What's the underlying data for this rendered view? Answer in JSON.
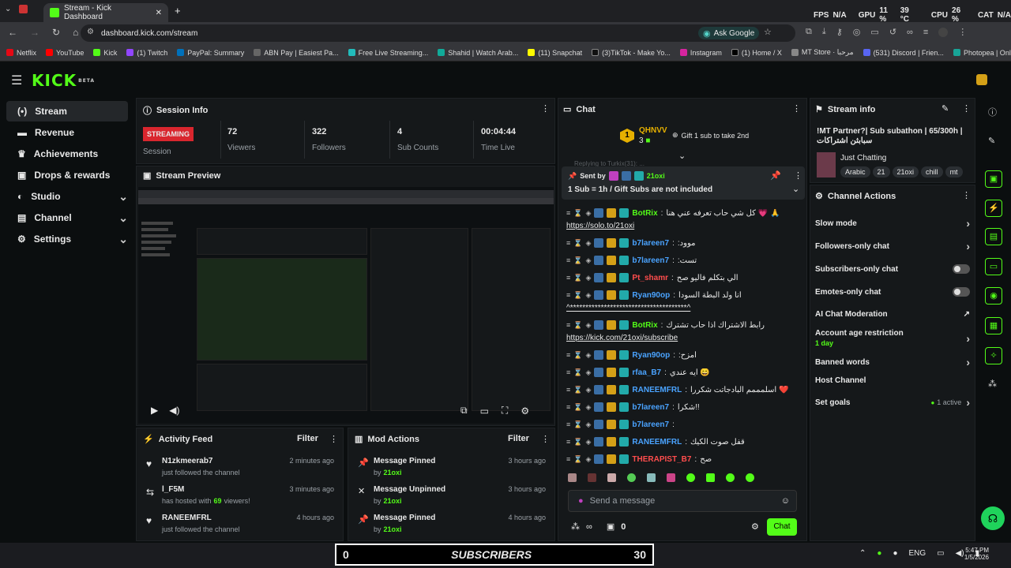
{
  "browser": {
    "tab_title": "Stream - Kick Dashboard",
    "url": "dashboard.kick.com/stream",
    "ask_google": "Ask Google",
    "overlay": {
      "fps_label": "FPS",
      "fps": "N/A",
      "gpu_label": "GPU",
      "gpu": "11 %",
      "gpu_temp": "39 °C",
      "cpu_label": "CPU",
      "cpu": "26 %",
      "cat": "CAT",
      "cat_val": "N/A"
    },
    "bookmarks": [
      "Netflix",
      "YouTube",
      "Kick",
      "(1) Twitch",
      "PayPal: Summary",
      "ABN Pay | Easiest Pa...",
      "Free Live Streaming...",
      "Shahid | Watch Arab...",
      "(11) Snapchat",
      "(3)TikTok - Make Yo...",
      "Instagram",
      "(1) Home / X",
      "MT Store · مرحبا",
      "(531) Discord | Frien...",
      "Photopea | Online P..."
    ]
  },
  "header": {
    "logo": "KICK",
    "beta": "BETA"
  },
  "sidebar": {
    "items": [
      {
        "label": "Stream"
      },
      {
        "label": "Revenue"
      },
      {
        "label": "Achievements"
      },
      {
        "label": "Drops & rewards"
      },
      {
        "label": "Studio"
      },
      {
        "label": "Channel"
      },
      {
        "label": "Settings"
      }
    ]
  },
  "session": {
    "title": "Session Info",
    "status": "STREAMING",
    "status_label": "Session",
    "stats": [
      {
        "value": "72",
        "label": "Viewers"
      },
      {
        "value": "322",
        "label": "Followers"
      },
      {
        "value": "4",
        "label": "Sub Counts"
      },
      {
        "value": "00:04:44",
        "label": "Time Live"
      }
    ]
  },
  "preview": {
    "title": "Stream Preview"
  },
  "activity": {
    "title": "Activity Feed",
    "filter": "Filter",
    "items": [
      {
        "name": "N1zkmeerab7",
        "desc": "just followed the channel",
        "time": "2 minutes ago"
      },
      {
        "name": "l_F5M",
        "desc_pre": "has hosted with",
        "count": "69",
        "desc_post": "viewers!",
        "time": "3 minutes ago"
      },
      {
        "name": "RANEEMFRL",
        "desc": "just followed the channel",
        "time": "4 hours ago"
      }
    ]
  },
  "mod": {
    "title": "Mod Actions",
    "filter": "Filter",
    "items": [
      {
        "action": "Message Pinned",
        "by": "by",
        "user": "21oxi",
        "time": "3 hours ago"
      },
      {
        "action": "Message Unpinned",
        "by": "by",
        "user": "21oxi",
        "time": "3 hours ago"
      },
      {
        "action": "Message Pinned",
        "by": "by",
        "user": "21oxi",
        "time": "4 hours ago"
      }
    ]
  },
  "chat": {
    "title": "Chat",
    "gift_user": "QHNVV",
    "gift_rank": "1",
    "gift_count": "3",
    "gift_cta": "Gift 1 sub to take 2nd",
    "replying": "Replying to Turkix(31): ...",
    "pinned": {
      "sent_by": "Sent by",
      "user": "21oxi",
      "text": "1 Sub = 1h / Gift Subs are not included"
    },
    "messages": [
      {
        "user": "BotRix",
        "color": "#53fc18",
        "text": "كل شي حاب تعرفه عني هنا 💗 🙏",
        "link": "https://solo.to/21oxi"
      },
      {
        "user": "b7lareen7",
        "color": "#4aa3ff",
        "text": ":موود"
      },
      {
        "user": "b7lareen7",
        "color": "#4aa3ff",
        "text": ":تست"
      },
      {
        "user": "Pt_shamr",
        "color": "#ff4d4d",
        "text": "الي بتكلم فاليو صح"
      },
      {
        "user": "Ryan90op",
        "color": "#4aa3ff",
        "text": "انا ولد البطة السودا",
        "link": "^**************************************^"
      },
      {
        "user": "BotRix",
        "color": "#53fc18",
        "text": "رابط الاشتراك اذا حاب تشترك",
        "link": "https://kick.com/21oxi/subscribe"
      },
      {
        "user": "Ryan90op",
        "color": "#4aa3ff",
        "text": ":امزح"
      },
      {
        "user": "rfaa_B7",
        "color": "#4aa3ff",
        "text": "ايه عندي 😄"
      },
      {
        "user": "RANEEMFRL",
        "color": "#4aa3ff",
        "text": "اسلمممم البادجاتت شكررا ❤️"
      },
      {
        "user": "b7lareen7",
        "color": "#4aa3ff",
        "text": "شكراً!!"
      },
      {
        "user": "b7lareen7",
        "color": "#4aa3ff",
        "text": ""
      },
      {
        "user": "RANEEMFRL",
        "color": "#4aa3ff",
        "text": "قفل صوت الكيك"
      },
      {
        "user": "THERAPIST_B7",
        "color": "#ff4d4d",
        "text": "صح"
      }
    ],
    "placeholder": "Send a message",
    "gift_bottom": "0",
    "send": "Chat"
  },
  "stream_info": {
    "title": "Stream info",
    "stream_title": "!MT Partner?| Sub subathon | 65/300h | سبابثن اشتراكات",
    "category": "Just Chatting",
    "tags": [
      "Arabic",
      "21",
      "21oxi",
      "chill",
      "mt"
    ]
  },
  "channel_actions": {
    "title": "Channel Actions",
    "items": [
      {
        "label": "Slow mode",
        "kind": "chevron"
      },
      {
        "label": "Followers-only chat",
        "kind": "chevron"
      },
      {
        "label": "Subscribers-only chat",
        "kind": "toggle"
      },
      {
        "label": "Emotes-only chat",
        "kind": "toggle"
      },
      {
        "label": "AI Chat Moderation",
        "kind": "external"
      },
      {
        "label": "Account age restriction",
        "sub": "1 day",
        "kind": "chevron"
      },
      {
        "label": "Banned words",
        "kind": "chevron"
      },
      {
        "label": "Host Channel",
        "kind": "none"
      },
      {
        "label": "Set goals",
        "sub": "1 active",
        "kind": "chevron"
      }
    ]
  },
  "overlay_banner": {
    "left": "0",
    "text": "SUBSCRIBERS",
    "right": "30"
  },
  "taskbar": {
    "lang": "ENG",
    "time": "5:47 PM",
    "date": "1/5/2026"
  }
}
